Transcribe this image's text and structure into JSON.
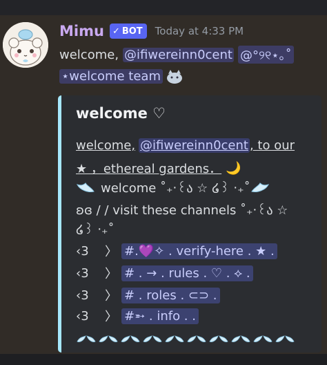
{
  "message": {
    "username": "Mimu",
    "bot_tag": "BOT",
    "timestamp": "Today at 4:33 PM",
    "line1_prefix": "welcome,",
    "user_mention": "@ifiwereinn0cent",
    "role_mention_1": "@°୨୧⋆｡˚",
    "role_mention_2": "⋆welcome team"
  },
  "embed": {
    "title": "welcome ♡",
    "accent_color": "#a6e7fb",
    "intro_prefix": "welcome,",
    "intro_mention": "@ifiwereinn0cent",
    "intro_suffix": ", to our",
    "line2": "★ ，ethereal gardens．",
    "line2_moon": "🌙",
    "line3_text": "welcome ˚₊‧꒰ა ☆ ໒꒱ ‧₊˚",
    "line4_text": "ʚɞ / / visit these channels ˚₊‧꒰ა ☆",
    "line5_text": "໒꒱ ‧₊˚",
    "channels": [
      {
        "lead": "‹3",
        "pointer": "〉",
        "name": "#.💜✧ . verify-here . ★ ."
      },
      {
        "lead": "‹3",
        "pointer": "〉",
        "name": "# . → . rules . ♡ . ⟡ ."
      },
      {
        "lead": "‹3",
        "pointer": "〉",
        "name": "# . roles . ⊂⊃ ."
      },
      {
        "lead": "‹3",
        "pointer": "〉",
        "name": "#➵ . info . ."
      }
    ]
  }
}
